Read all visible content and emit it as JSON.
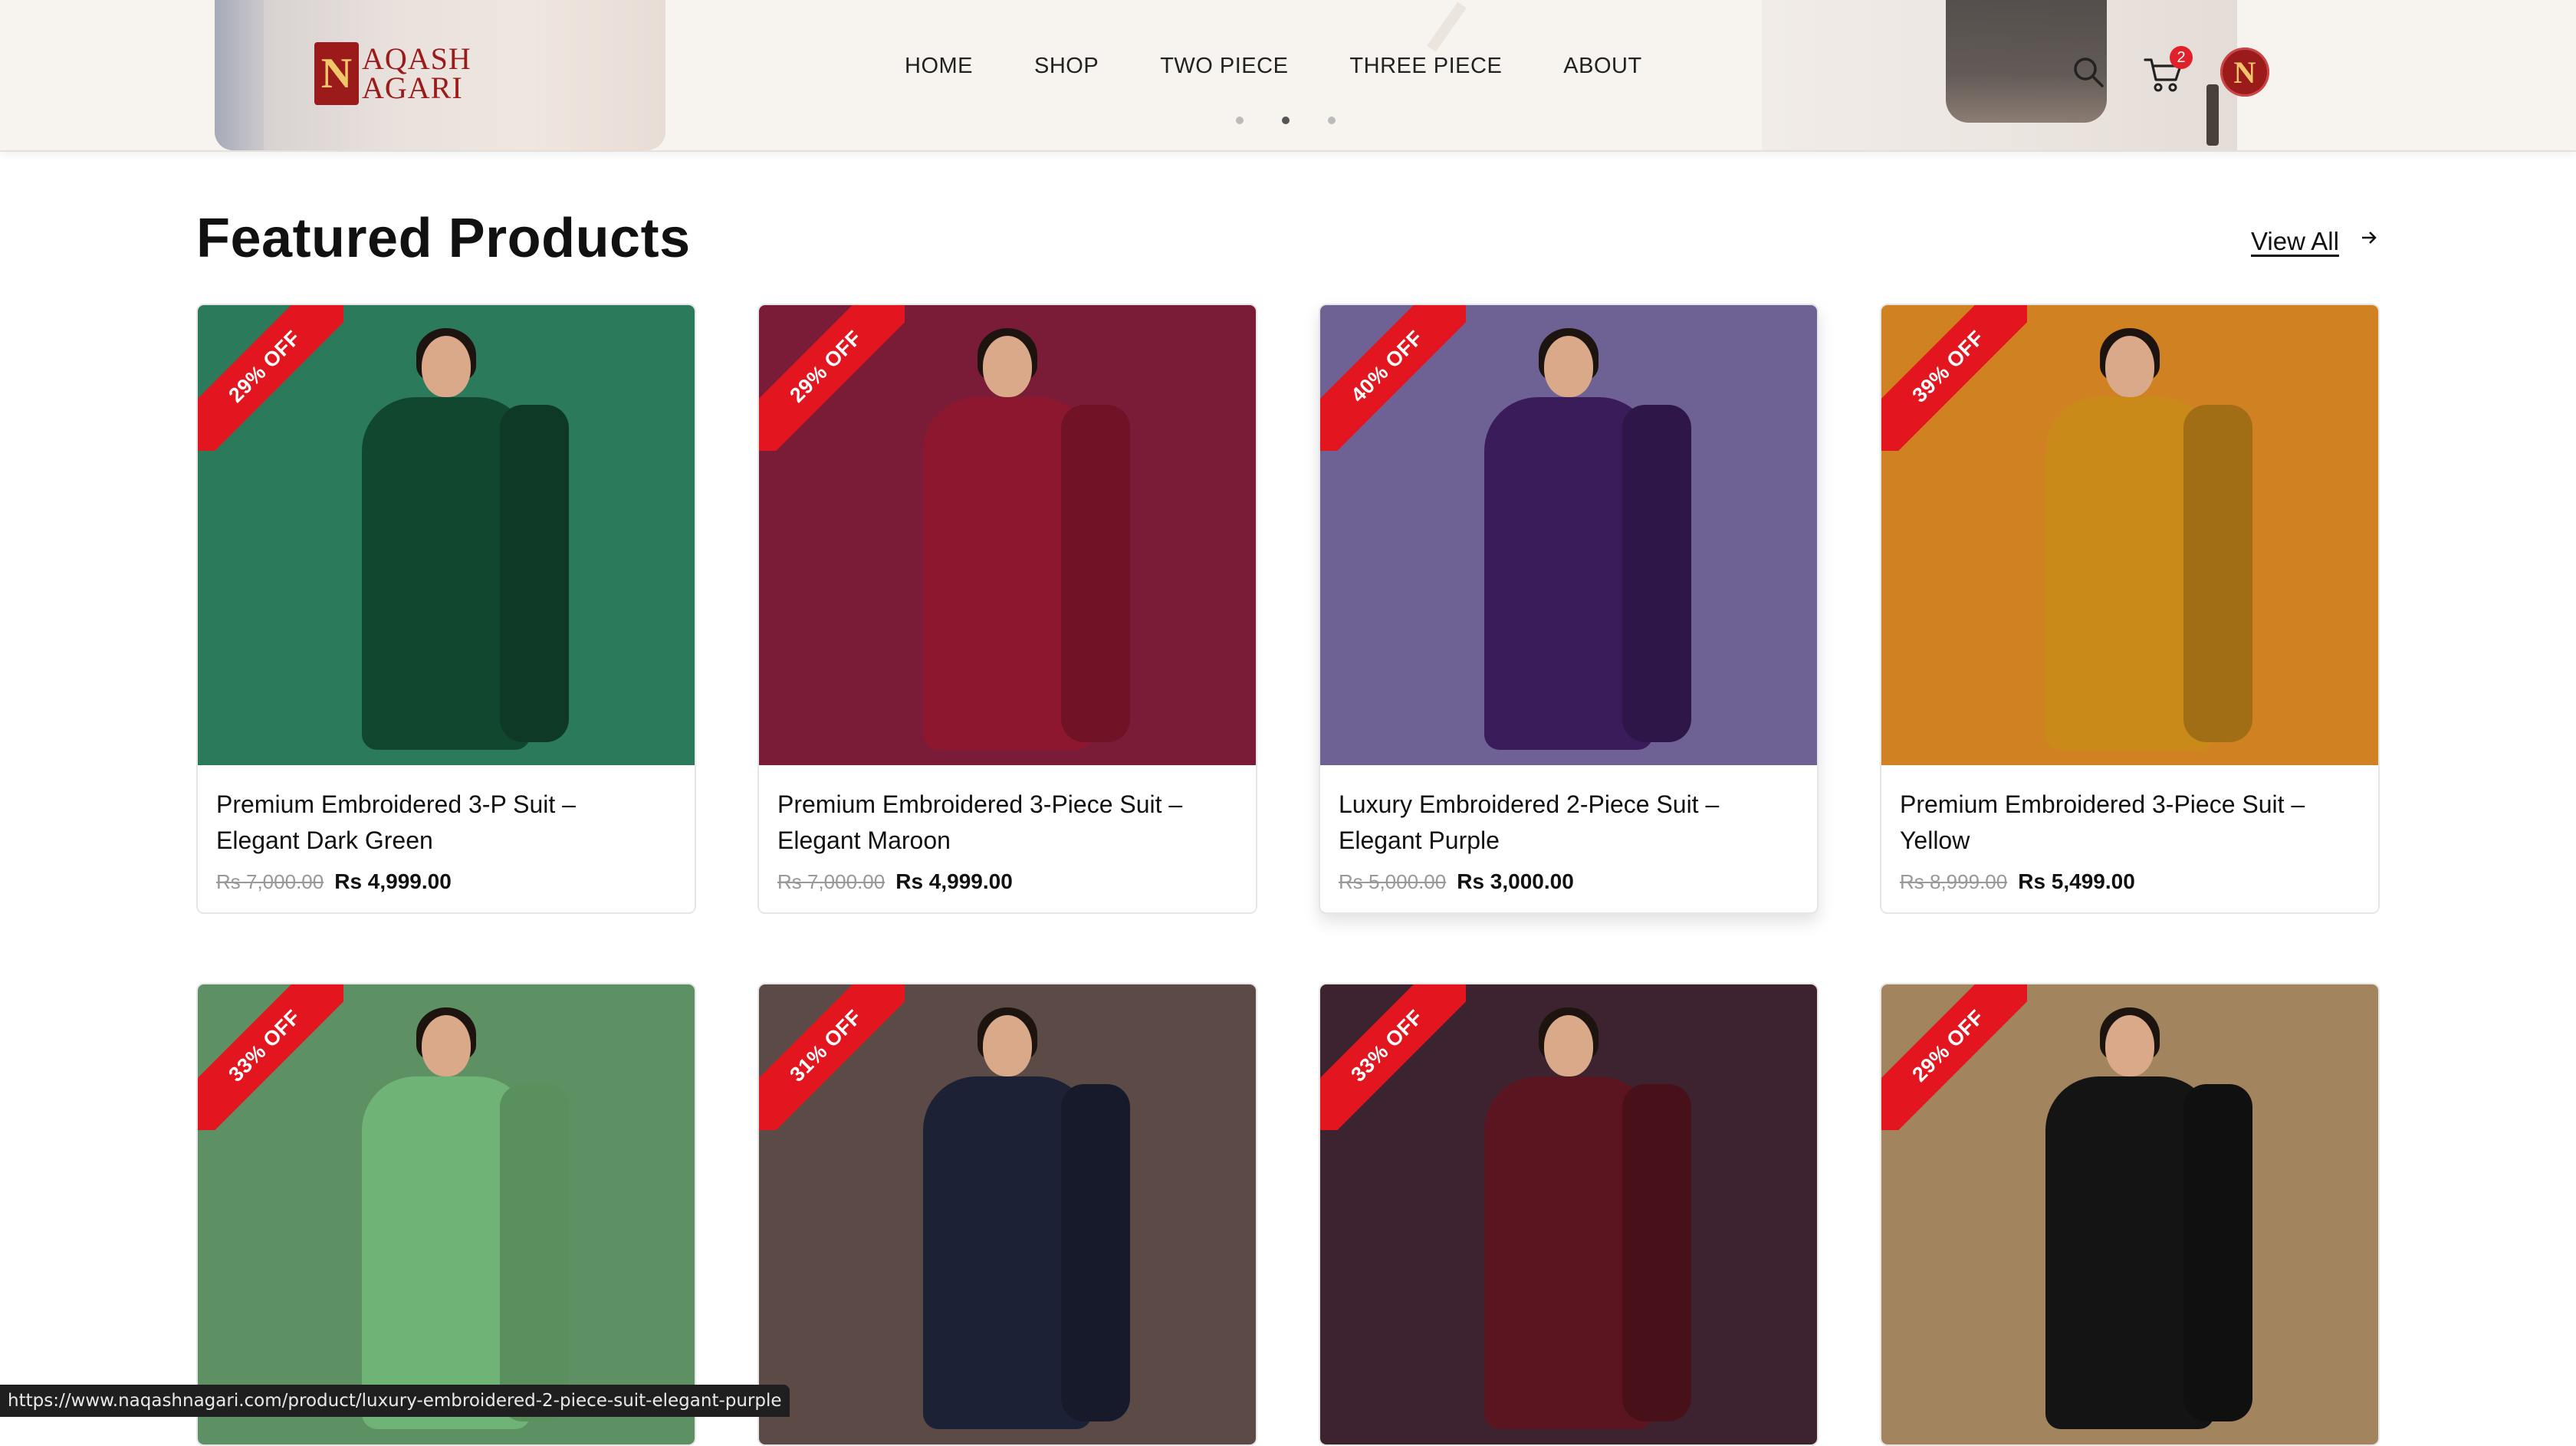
{
  "header": {
    "brand_line1": "AQASH",
    "brand_line2": "AGARI",
    "brand_mark": "N",
    "nav": [
      {
        "label": "HOME"
      },
      {
        "label": "SHOP"
      },
      {
        "label": "TWO PIECE"
      },
      {
        "label": "THREE PIECE"
      },
      {
        "label": "ABOUT"
      }
    ],
    "carousel_dots": 3,
    "carousel_active_index": 1,
    "cart_count": "2",
    "avatar_letter": "N",
    "icons": [
      "search-icon",
      "cart-icon"
    ]
  },
  "section": {
    "title": "Featured Products",
    "view_all": "View All"
  },
  "products": [
    {
      "title_line1": "Premium Embroidered 3-P Suit –",
      "title_line2": "Elegant Dark Green",
      "old_price": "Rs 7,000.00",
      "new_price": "Rs 4,999.00",
      "discount": "29% OFF",
      "bg": "#2b7a5c",
      "dress": "#12472f"
    },
    {
      "title_line1": "Premium Embroidered 3-Piece Suit –",
      "title_line2": "Elegant Maroon",
      "old_price": "Rs 7,000.00",
      "new_price": "Rs 4,999.00",
      "discount": "29% OFF",
      "bg": "#7a1c38",
      "dress": "#8e1730"
    },
    {
      "title_line1": "Luxury Embroidered 2-Piece Suit –",
      "title_line2": "Elegant Purple",
      "old_price": "Rs 5,000.00",
      "new_price": "Rs 3,000.00",
      "discount": "40% OFF",
      "bg": "#6e6295",
      "dress": "#3a1c5a"
    },
    {
      "title_line1": "Premium Embroidered 3-Piece Suit –",
      "title_line2": "Yellow",
      "old_price": "Rs 8,999.00",
      "new_price": "Rs 5,499.00",
      "discount": "39% OFF",
      "bg": "#d08121",
      "dress": "#c98a1a"
    },
    {
      "title_line1": "",
      "title_line2": "",
      "old_price": "",
      "new_price": "",
      "discount": "33% OFF",
      "bg": "#5d9163",
      "dress": "#6fb476"
    },
    {
      "title_line1": "",
      "title_line2": "",
      "old_price": "",
      "new_price": "",
      "discount": "31% OFF",
      "bg": "#5b4a45",
      "dress": "#1d2136"
    },
    {
      "title_line1": "",
      "title_line2": "",
      "old_price": "",
      "new_price": "",
      "discount": "33% OFF",
      "bg": "#3d2230",
      "dress": "#5a1520"
    },
    {
      "title_line1": "",
      "title_line2": "",
      "old_price": "",
      "new_price": "",
      "discount": "29% OFF",
      "bg": "#a2855f",
      "dress": "#141414"
    }
  ],
  "status_url": "https://www.naqashnagari.com/product/luxury-embroidered-2-piece-suit-elegant-purple"
}
